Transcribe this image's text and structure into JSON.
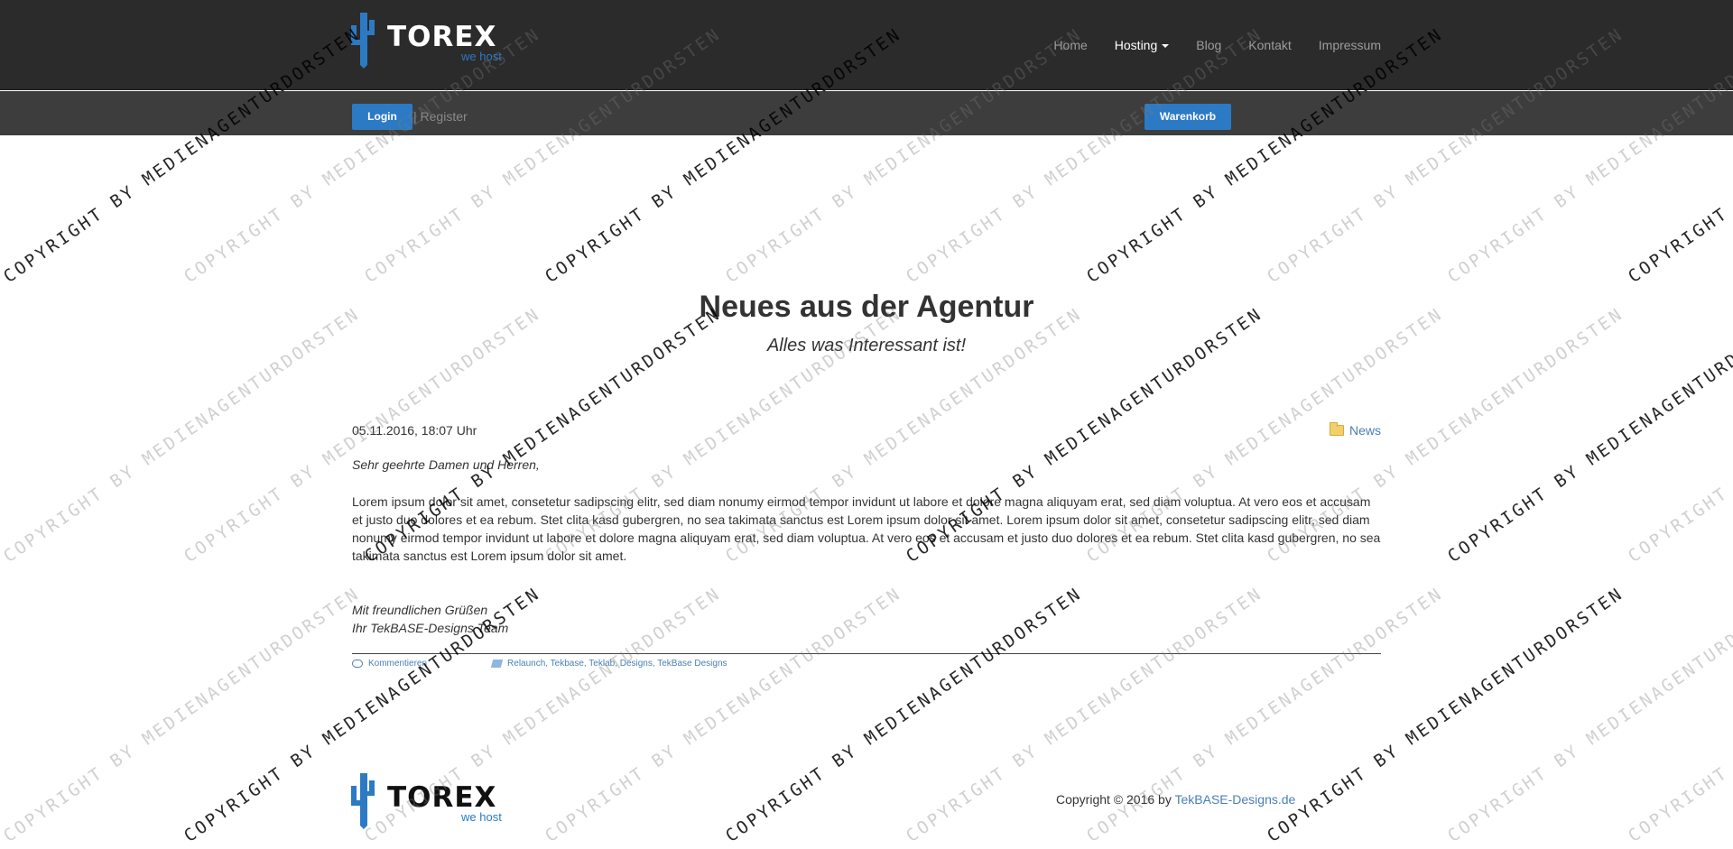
{
  "brand": {
    "name": "TOREX",
    "tagline": "we host"
  },
  "nav": {
    "items": [
      {
        "label": "Home"
      },
      {
        "label": "Hosting",
        "active": true,
        "dropdown": true
      },
      {
        "label": "Blog"
      },
      {
        "label": "Kontakt"
      },
      {
        "label": "Impressum"
      }
    ]
  },
  "subbar": {
    "login_label": "Login",
    "register_label": "| Register",
    "cart_label": "Warenkorb"
  },
  "hero": {
    "title": "Neues aus der Agentur",
    "subtitle": "Alles was Interessant ist!"
  },
  "post": {
    "date": "05.11.2016, 18:07 Uhr",
    "category": "News",
    "greeting": "Sehr geehrte Damen und Herren,",
    "body": "Lorem ipsum dolor sit amet, consetetur sadipscing elitr, sed diam nonumy eirmod tempor invidunt ut labore et dolore magna aliquyam erat, sed diam voluptua. At vero eos et accusam et justo duo dolores et ea rebum. Stet clita kasd gubergren, no sea takimata sanctus est Lorem ipsum dolor sit amet. Lorem ipsum dolor sit amet, consetetur sadipscing elitr, sed diam nonumy eirmod tempor invidunt ut labore et dolore magna aliquyam erat, sed diam voluptua. At vero eos et accusam et justo duo dolores et ea rebum. Stet clita kasd gubergren, no sea takimata sanctus est Lorem ipsum dolor sit amet.",
    "closing_line1": "Mit freundlichen Grüßen",
    "closing_line2": "Ihr TekBASE-Designs Team",
    "comment_label": "Kommentieren",
    "tags_label": "Relaunch, Tekbase, Teklab, Designs, TekBase Designs"
  },
  "footer": {
    "copyright_prefix": "Copyright © 2016 by",
    "copyright_link": "TekBASE-Designs.de"
  },
  "watermark": {
    "text": "COPYRIGHT BY MEDIENAGENTURDORSTEN"
  },
  "colors": {
    "topbar": "#2b2b2b",
    "subbar": "#3d3d3d",
    "accent": "#2d7ac4",
    "link": "#4a7fb5"
  }
}
